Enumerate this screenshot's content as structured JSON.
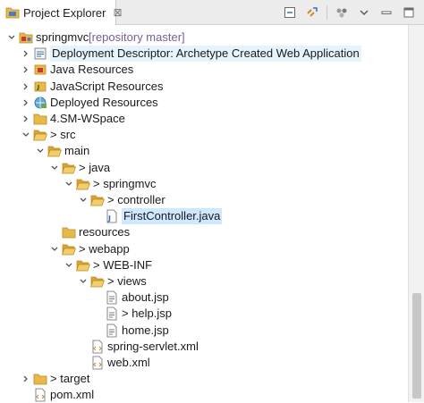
{
  "view": {
    "tab_title": "Project Explorer",
    "tab_close": "⊠",
    "toolbar_icons": [
      "collapse-all-icon",
      "link-with-editor-icon",
      "filters-icon",
      "view-menu-icon",
      "minimize-icon",
      "maximize-icon"
    ]
  },
  "tree": [
    {
      "label": "springmvc",
      "decoration": " [repository master]",
      "icon": "project",
      "chevron": "down",
      "depth": 0
    },
    {
      "label": "Deployment Descriptor: Archetype Created Web Application",
      "icon": "deployment-descriptor",
      "chevron": "right",
      "depth": 1,
      "hover": true
    },
    {
      "label": "Java Resources",
      "icon": "java-resources",
      "chevron": "right",
      "depth": 1
    },
    {
      "label": "JavaScript Resources",
      "icon": "javascript-resources",
      "chevron": "right",
      "depth": 1
    },
    {
      "label": "Deployed Resources",
      "icon": "deployed-resources",
      "chevron": "right",
      "depth": 1
    },
    {
      "label": "4.SM-WSpace",
      "icon": "folder",
      "chevron": "right",
      "depth": 1
    },
    {
      "label": "> src",
      "icon": "folder-open",
      "chevron": "down",
      "depth": 1
    },
    {
      "label": "main",
      "icon": "folder-open",
      "chevron": "down",
      "depth": 2
    },
    {
      "label": "> java",
      "icon": "folder-open",
      "chevron": "down",
      "depth": 3
    },
    {
      "label": "> springmvc",
      "icon": "folder-open",
      "chevron": "down",
      "depth": 4
    },
    {
      "label": "> controller",
      "icon": "folder-open",
      "chevron": "down",
      "depth": 5
    },
    {
      "label": "FirstController.java",
      "icon": "java-file",
      "chevron": "",
      "depth": 6,
      "selected": true
    },
    {
      "label": "resources",
      "icon": "folder",
      "chevron": "",
      "depth": 3
    },
    {
      "label": "> webapp",
      "icon": "folder-open",
      "chevron": "down",
      "depth": 3
    },
    {
      "label": "> WEB-INF",
      "icon": "folder-open",
      "chevron": "down",
      "depth": 4
    },
    {
      "label": "> views",
      "icon": "folder-open",
      "chevron": "down",
      "depth": 5
    },
    {
      "label": "about.jsp",
      "icon": "jsp-file",
      "chevron": "",
      "depth": 6
    },
    {
      "label": "> help.jsp",
      "icon": "jsp-file",
      "chevron": "",
      "depth": 6
    },
    {
      "label": "home.jsp",
      "icon": "jsp-file",
      "chevron": "",
      "depth": 6
    },
    {
      "label": "spring-servlet.xml",
      "icon": "xml-file",
      "chevron": "",
      "depth": 5
    },
    {
      "label": "web.xml",
      "icon": "xml-file",
      "chevron": "",
      "depth": 5
    },
    {
      "label": "> target",
      "icon": "folder",
      "chevron": "right",
      "depth": 1
    },
    {
      "label": "pom.xml",
      "icon": "xml-file",
      "chevron": "",
      "depth": 1
    }
  ],
  "colors": {
    "folder": "#e8b84a",
    "selection": "#cde8ff",
    "hover": "#e5f3fb",
    "decoration": "#7a5c96"
  }
}
